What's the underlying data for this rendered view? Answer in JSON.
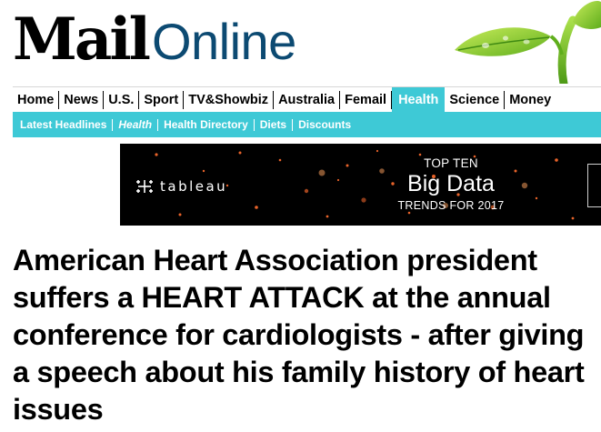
{
  "masthead": {
    "logo_primary": "Mail",
    "logo_secondary": "Online"
  },
  "nav": {
    "primary": [
      {
        "label": "Home"
      },
      {
        "label": "News"
      },
      {
        "label": "U.S."
      },
      {
        "label": "Sport"
      },
      {
        "label": "TV&Showbiz"
      },
      {
        "label": "Australia"
      },
      {
        "label": "Femail"
      },
      {
        "label": "Health",
        "active": true
      },
      {
        "label": "Science"
      },
      {
        "label": "Money"
      }
    ],
    "secondary": [
      {
        "label": "Latest Headlines"
      },
      {
        "label": "Health",
        "current": true
      },
      {
        "label": "Health Directory"
      },
      {
        "label": "Diets"
      },
      {
        "label": "Discounts"
      }
    ]
  },
  "ad": {
    "brand": "tableau",
    "line1": "TOP TEN",
    "line2": "Big Data",
    "line3": "TRENDS FOR 2017"
  },
  "article": {
    "headline": "American Heart Association president suffers a HEART ATTACK at the annual conference for cardiologists - after giving a speech about his family history of heart issues"
  },
  "colors": {
    "accent": "#3ec9d6",
    "logo_online": "#0c4a72",
    "ad_background": "#000000"
  }
}
